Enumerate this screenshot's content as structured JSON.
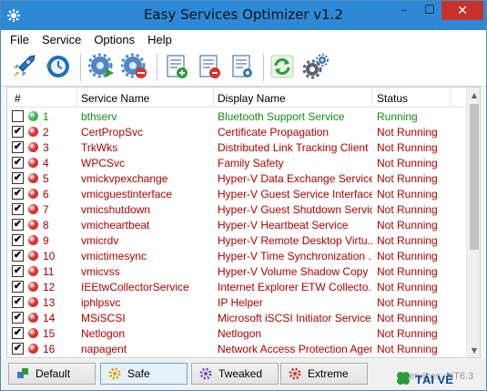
{
  "window": {
    "title": "Easy Services Optimizer v1.2",
    "minimize": "–",
    "maximize": "☐",
    "close": "✕"
  },
  "menu": [
    "File",
    "Service",
    "Options",
    "Help"
  ],
  "toolbar": {
    "tools": [
      {
        "icon": "rocket-optimize-icon"
      },
      {
        "icon": "restore-clock-icon"
      },
      {
        "icon": "start-service-icon"
      },
      {
        "icon": "stop-service-icon"
      },
      {
        "icon": "add-list-icon"
      },
      {
        "icon": "remove-list-icon"
      },
      {
        "icon": "list-settings-icon"
      },
      {
        "icon": "refresh-icon"
      },
      {
        "icon": "settings-gears-icon"
      }
    ]
  },
  "list": {
    "headers": {
      "num": "#",
      "name": "Service Name",
      "display": "Display Name",
      "status": "Status"
    },
    "rows": [
      {
        "checked": false,
        "running": true,
        "num": "1",
        "name": "bthserv",
        "display": "Bluetooth Support Service",
        "status": "Running"
      },
      {
        "checked": true,
        "running": false,
        "num": "2",
        "name": "CertPropSvc",
        "display": "Certificate Propagation",
        "status": "Not Running"
      },
      {
        "checked": true,
        "running": false,
        "num": "3",
        "name": "TrkWks",
        "display": "Distributed Link Tracking Client",
        "status": "Not Running"
      },
      {
        "checked": true,
        "running": false,
        "num": "4",
        "name": "WPCSvc",
        "display": "Family Safety",
        "status": "Not Running"
      },
      {
        "checked": true,
        "running": false,
        "num": "5",
        "name": "vmickvpexchange",
        "display": "Hyper-V Data Exchange Service",
        "status": "Not Running"
      },
      {
        "checked": true,
        "running": false,
        "num": "6",
        "name": "vmicguestinterface",
        "display": "Hyper-V Guest Service Interface",
        "status": "Not Running"
      },
      {
        "checked": true,
        "running": false,
        "num": "7",
        "name": "vmicshutdown",
        "display": "Hyper-V Guest Shutdown Service",
        "status": "Not Running"
      },
      {
        "checked": true,
        "running": false,
        "num": "8",
        "name": "vmicheartbeat",
        "display": "Hyper-V Heartbeat Service",
        "status": "Not Running"
      },
      {
        "checked": true,
        "running": false,
        "num": "9",
        "name": "vmicrdv",
        "display": "Hyper-V Remote Desktop Virtu...",
        "status": "Not Running"
      },
      {
        "checked": true,
        "running": false,
        "num": "10",
        "name": "vmictimesync",
        "display": "Hyper-V Time Synchronization ...",
        "status": "Not Running"
      },
      {
        "checked": true,
        "running": false,
        "num": "11",
        "name": "vmicvss",
        "display": "Hyper-V Volume Shadow Copy ...",
        "status": "Not Running"
      },
      {
        "checked": true,
        "running": false,
        "num": "12",
        "name": "IEEtwCollectorService",
        "display": "Internet Explorer ETW Collecto...",
        "status": "Not Running"
      },
      {
        "checked": true,
        "running": false,
        "num": "13",
        "name": "iphlpsvc",
        "display": "IP Helper",
        "status": "Not Running"
      },
      {
        "checked": true,
        "running": false,
        "num": "14",
        "name": "MSiSCSI",
        "display": "Microsoft iSCSI Initiator Service",
        "status": "Not Running"
      },
      {
        "checked": true,
        "running": false,
        "num": "15",
        "name": "Netlogon",
        "display": "Netlogon",
        "status": "Not Running"
      },
      {
        "checked": true,
        "running": false,
        "num": "16",
        "name": "napagent",
        "display": "Network Access Protection Agent",
        "status": "Not Running"
      }
    ]
  },
  "colors": {
    "running": "#158c15",
    "not_running": "#b00000",
    "titlebar": "#2d89d6"
  },
  "presets": [
    {
      "label": "Default",
      "icon": "default-preset-icon",
      "active": false
    },
    {
      "label": "Safe",
      "icon": "safe-preset-icon",
      "active": true
    },
    {
      "label": "Tweaked",
      "icon": "tweaked-preset-icon",
      "active": false
    },
    {
      "label": "Extreme",
      "icon": "extreme-preset-icon",
      "active": false
    }
  ],
  "status_text": "Services: NT6.3",
  "watermark": "TẢI VỀ"
}
